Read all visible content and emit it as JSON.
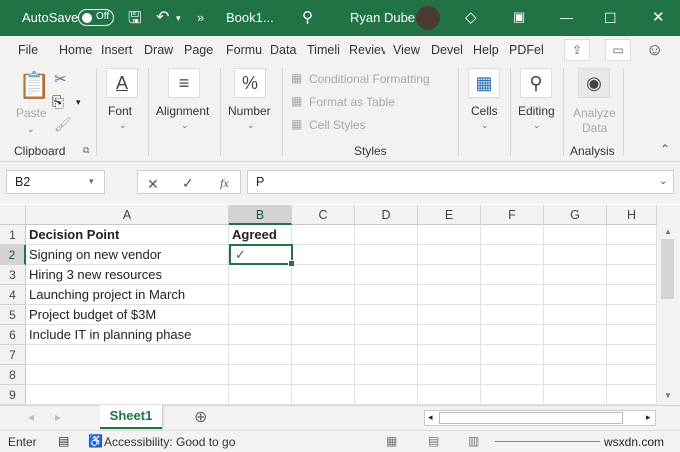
{
  "title_bar": {
    "autosave_label": "AutoSave",
    "autosave_state": "Off",
    "workbook": "Book1...",
    "user": "Ryan Dube",
    "colors": {
      "accent": "#217346"
    }
  },
  "tabs": [
    "File",
    "Home",
    "Insert",
    "Draw",
    "Page",
    "Formu",
    "Data",
    "Timeli",
    "Reviev",
    "View",
    "Devel",
    "Help",
    "PDFel"
  ],
  "active_tab": "Home",
  "ribbon": {
    "clipboard": {
      "paste": "Paste",
      "group": "Clipboard"
    },
    "font": "Font",
    "alignment": "Alignment",
    "number": "Number",
    "styles": {
      "conditional": "Conditional Formatting",
      "table": "Format as Table",
      "cell_styles": "Cell Styles",
      "group": "Styles"
    },
    "cells": "Cells",
    "editing": "Editing",
    "analysis": {
      "analyze": "Analyze",
      "data": "Data",
      "group": "Analysis"
    }
  },
  "formula_bar": {
    "name_box": "B2",
    "content": "P",
    "fx": "fx"
  },
  "columns": [
    "A",
    "B",
    "C",
    "D",
    "E",
    "F",
    "G",
    "H"
  ],
  "rows": [
    {
      "n": "1",
      "a": "Decision Point",
      "b": "Agreed"
    },
    {
      "n": "2",
      "a": "Signing on new vendor",
      "b": "✓"
    },
    {
      "n": "3",
      "a": "Hiring 3 new resources",
      "b": ""
    },
    {
      "n": "4",
      "a": "Launching project in March",
      "b": ""
    },
    {
      "n": "5",
      "a": "Project budget of $3M",
      "b": ""
    },
    {
      "n": "6",
      "a": "Include IT in planning phase",
      "b": ""
    },
    {
      "n": "7",
      "a": "",
      "b": ""
    },
    {
      "n": "8",
      "a": "",
      "b": ""
    },
    {
      "n": "9",
      "a": "",
      "b": ""
    }
  ],
  "sheet_tab": "Sheet1",
  "status": {
    "mode": "Enter",
    "accessibility": "Accessibility: Good to go",
    "watermark": "wsxdn.com"
  }
}
